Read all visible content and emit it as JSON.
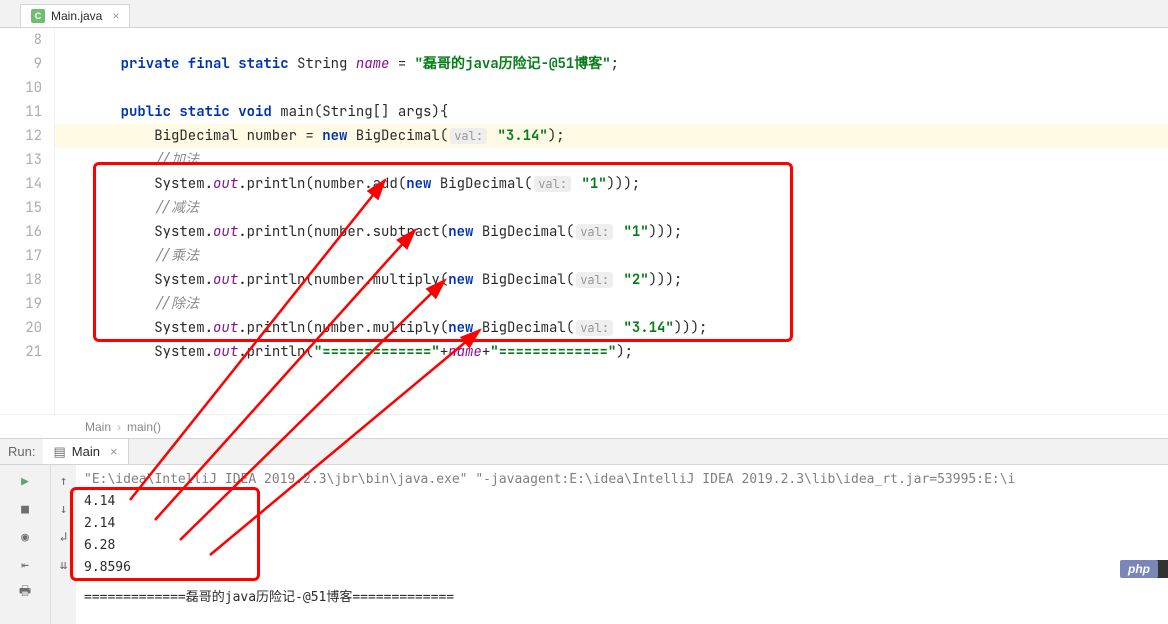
{
  "tab": {
    "filename": "Main.java"
  },
  "gutter": [
    "8",
    "9",
    "10",
    "11",
    "12",
    "13",
    "14",
    "15",
    "16",
    "17",
    "18",
    "19",
    "20",
    "21"
  ],
  "code": {
    "l9": {
      "mods": "private final static",
      "type": "String",
      "name": "name",
      "eq": "=",
      "str": "\"磊哥的java历险记-@51博客\"",
      "end": ";"
    },
    "l11": {
      "mods": "public static void",
      "method": "main",
      "params": "(String[] args){"
    },
    "l12": {
      "lhs": "BigDecimal number = ",
      "kw": "new",
      "cls": " BigDecimal(",
      "hint": "val:",
      "str": "\"3.14\"",
      "end": ");"
    },
    "l13": "//加法",
    "l14": {
      "pre": "System.",
      "out": "out",
      "mid": ".println(number.add(",
      "kw": "new",
      "cls": " BigDecimal(",
      "hint": "val:",
      "str": "\"1\"",
      "end": ")));"
    },
    "l15": "//减法",
    "l16": {
      "pre": "System.",
      "out": "out",
      "mid": ".println(number.subtract(",
      "kw": "new",
      "cls": " BigDecimal(",
      "hint": "val:",
      "str": "\"1\"",
      "end": ")));"
    },
    "l17": "//乘法",
    "l18": {
      "pre": "System.",
      "out": "out",
      "mid": ".println(number.multiply(",
      "kw": "new",
      "cls": " BigDecimal(",
      "hint": "val:",
      "str": "\"2\"",
      "end": ")));"
    },
    "l19": "//除法",
    "l20": {
      "pre": "System.",
      "out": "out",
      "mid": ".println(number.multiply(",
      "kw": "new",
      "cls": " BigDecimal(",
      "hint": "val:",
      "str": "\"3.14\"",
      "end": ")));"
    },
    "l21": {
      "pre": "System.",
      "out": "out",
      "mid": ".println(",
      "str1": "\"=============\"",
      "plus": "+",
      "name": "name",
      "plus2": "+",
      "str2": "\"=============\"",
      "end": ");"
    }
  },
  "breadcrumb": {
    "a": "Main",
    "b": "main()"
  },
  "run": {
    "label": "Run:",
    "tab": "Main",
    "cmd": "\"E:\\idea\\IntelliJ IDEA 2019.2.3\\jbr\\bin\\java.exe\" \"-javaagent:E:\\idea\\IntelliJ IDEA 2019.2.3\\lib\\idea_rt.jar=53995:E:\\i",
    "out": [
      "4.14",
      "2.14",
      "6.28",
      "9.8596"
    ],
    "sep": "=============磊哥的java历险记-@51博客============="
  },
  "badge": "php"
}
